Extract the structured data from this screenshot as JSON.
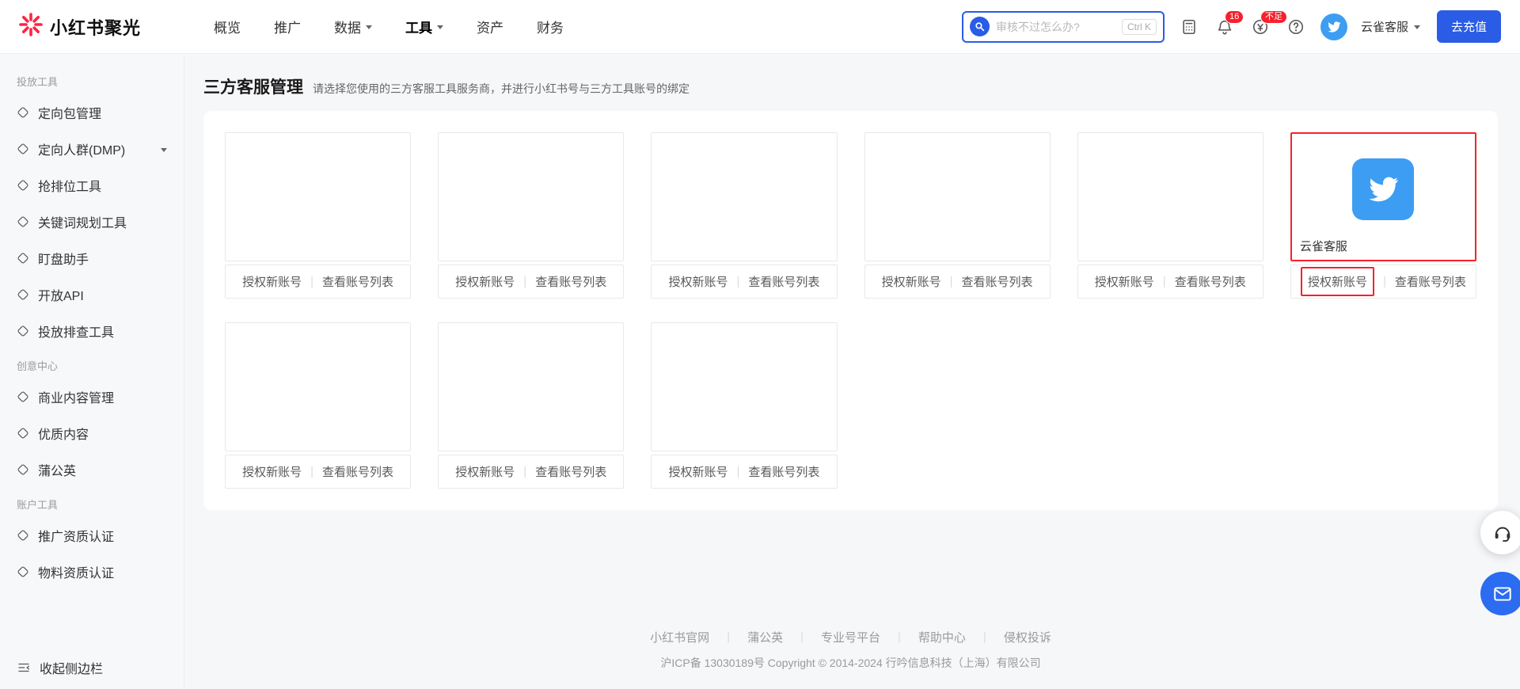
{
  "topbar": {
    "brand": "小红书聚光",
    "nav": [
      "概览",
      "推广",
      "数据",
      "工具",
      "资产",
      "财务"
    ],
    "search": {
      "placeholder": "审核不过怎么办?",
      "shortcut": "Ctrl K"
    },
    "bell_badge": "16",
    "credit_badge": "不足",
    "username": "云雀客服",
    "recharge": "去充值"
  },
  "sidebar": {
    "sections": [
      {
        "label": "投放工具",
        "items": [
          "定向包管理",
          "定向人群(DMP)",
          "抢排位工具",
          "关键词规划工具",
          "盯盘助手",
          "开放API",
          "投放排查工具"
        ]
      },
      {
        "label": "创意中心",
        "items": [
          "商业内容管理",
          "优质内容",
          "蒲公英"
        ]
      },
      {
        "label": "账户工具",
        "items": [
          "推广资质认证",
          "物料资质认证"
        ]
      }
    ],
    "collapse": "收起侧边栏"
  },
  "main": {
    "title": "三方客服管理",
    "subtitle": "请选择您使用的三方客服工具服务商，并进行小红书号与三方工具账号的绑定",
    "cards": [
      "",
      "",
      "",
      "",
      "",
      "云雀客服",
      "",
      "",
      ""
    ],
    "highlighted_card": "云雀客服",
    "card_actions": {
      "authorize": "授权新账号",
      "divider": "|",
      "view_list": "查看账号列表"
    }
  },
  "footer": {
    "links": [
      "小红书官网",
      "蒲公英",
      "专业号平台",
      "帮助中心",
      "侵权投诉"
    ],
    "divider": "|",
    "copyright": "沪ICP备 13030189号 Copyright © 2014-2024 行吟信息科技（上海）有限公司"
  },
  "colors": {
    "accent_blue": "#2b5ce5",
    "brand_red": "#ff2442",
    "highlight_red": "#f5222d",
    "bird_blue": "#3d9df3"
  }
}
